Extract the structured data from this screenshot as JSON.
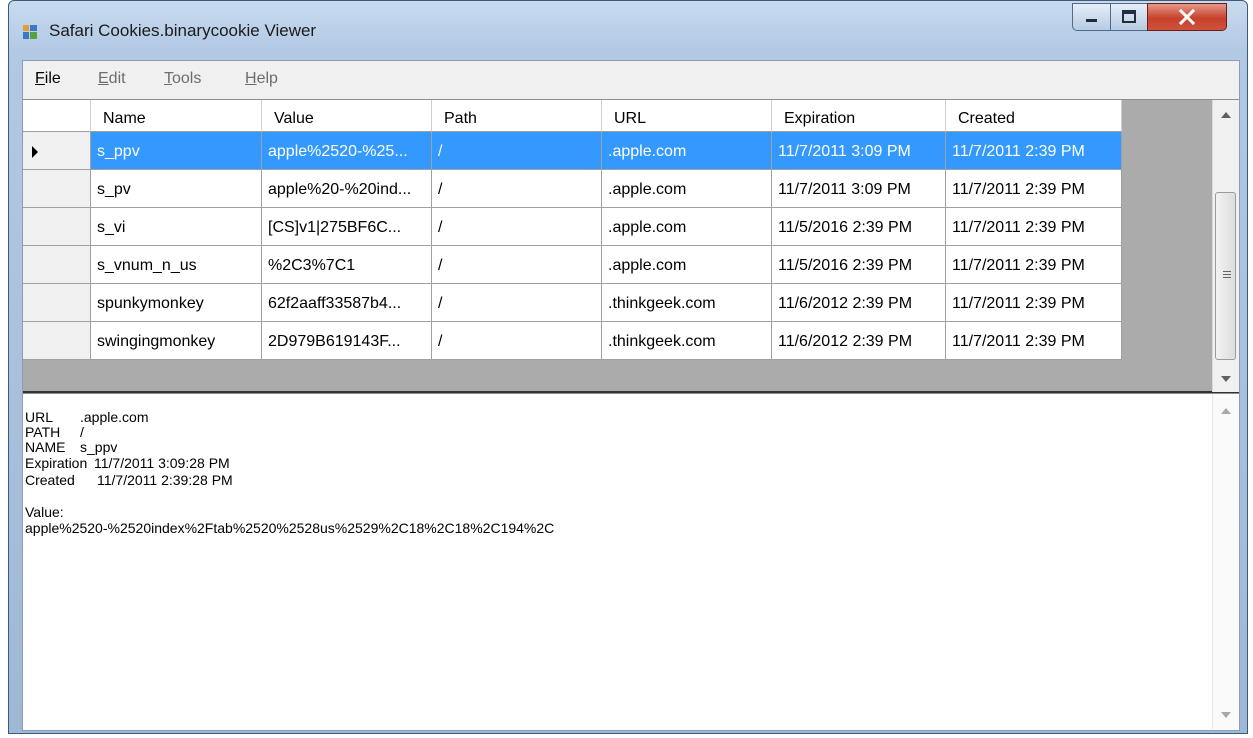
{
  "window": {
    "title": "Safari Cookies.binarycookie Viewer"
  },
  "menu": {
    "file": {
      "mnemonic": "F",
      "rest": "ile"
    },
    "edit": {
      "mnemonic": "E",
      "rest": "dit"
    },
    "tools": {
      "mnemonic": "T",
      "rest": "ools"
    },
    "help": {
      "mnemonic": "H",
      "rest": "elp"
    }
  },
  "grid": {
    "columns": [
      "Name",
      "Value",
      "Path",
      "URL",
      "Expiration",
      "Created"
    ],
    "rows": [
      {
        "name": "s_ppv",
        "value": "apple%2520-%25...",
        "path": "/",
        "url": ".apple.com",
        "expiration": "11/7/2011 3:09 PM",
        "created": "11/7/2011 2:39 PM",
        "selected": true
      },
      {
        "name": "s_pv",
        "value": "apple%20-%20ind...",
        "path": "/",
        "url": ".apple.com",
        "expiration": "11/7/2011 3:09 PM",
        "created": "11/7/2011 2:39 PM"
      },
      {
        "name": "s_vi",
        "value": "[CS]v1|275BF6C...",
        "path": "/",
        "url": ".apple.com",
        "expiration": "11/5/2016 2:39 PM",
        "created": "11/7/2011 2:39 PM"
      },
      {
        "name": "s_vnum_n_us",
        "value": "%2C3%7C1",
        "path": "/",
        "url": ".apple.com",
        "expiration": "11/5/2016 2:39 PM",
        "created": "11/7/2011 2:39 PM"
      },
      {
        "name": "spunkymonkey",
        "value": "62f2aaff33587b4...",
        "path": "/",
        "url": ".thinkgeek.com",
        "expiration": "11/6/2012 2:39 PM",
        "created": "11/7/2011 2:39 PM"
      },
      {
        "name": "swingingmonkey",
        "value": "2D979B619143F...",
        "path": "/",
        "url": ".thinkgeek.com",
        "expiration": "11/6/2012 2:39 PM",
        "created": "11/7/2011 2:39 PM"
      }
    ]
  },
  "detail": {
    "url_label": "URL",
    "url_value": ".apple.com",
    "path_label": "PATH",
    "path_value": "/",
    "name_label": "NAME",
    "name_value": "s_ppv",
    "expiration_label": "Expiration",
    "expiration_value": "11/7/2011 3:09:28 PM",
    "created_label": "Created",
    "created_value": "11/7/2011 2:39:28 PM",
    "value_label": "Value:",
    "value_text": "apple%2520-%2520index%2Ftab%2520%2528us%2529%2C18%2C18%2C194%2C"
  },
  "colors": {
    "selection": "#3399ff",
    "close_button": "#c7412c"
  },
  "icons": [
    "app-icon",
    "minimize-icon",
    "maximize-icon",
    "close-icon",
    "row-selector-arrow-icon",
    "scroll-up-icon",
    "scroll-down-icon",
    "scroll-grip-icon"
  ]
}
